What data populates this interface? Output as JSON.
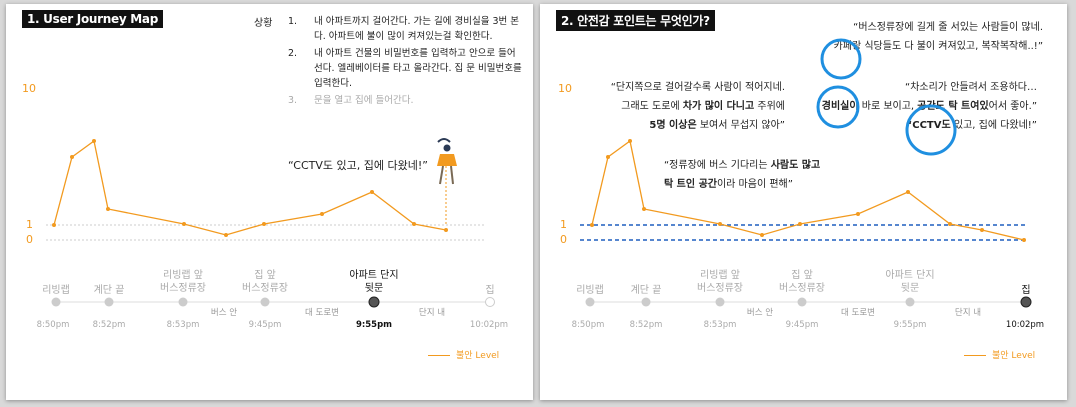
{
  "colors": {
    "line": "#f29a1f",
    "accent_blue": "#1f8fe0",
    "dashed_blue": "#1f5fbf"
  },
  "panel1": {
    "title": "1. User Journey Map",
    "steps_label": "상황",
    "steps": [
      {
        "num": "1.",
        "text": "내 아파트까지 걸어간다. 가는 길에 경비실을 3번 본다. 아파트에 불이 많이 켜져있는걸 확인한다."
      },
      {
        "num": "2.",
        "text": "내 아파트 건물의 비밀번호를 입력하고 안으로 들어선다. 엘레베이터를 타고 올라간다. 집 문 비밀번호를 입력한다."
      },
      {
        "num": "3.",
        "text": "문을 열고 집에 들어간다."
      }
    ],
    "quote": "“CCTV도 있고, 집에 다왔네!”",
    "figure_icon": "walking-woman-icon",
    "y_labels": {
      "top": "10",
      "one": "1",
      "zero": "0"
    },
    "stations": [
      {
        "name1": "리빙랩",
        "name2": "",
        "time": "8:50pm"
      },
      {
        "name1": "계단 끝",
        "name2": "",
        "time": "8:52pm"
      },
      {
        "name1": "리빙랩 앞",
        "name2": "버스정류장",
        "time": "8:53pm"
      },
      {
        "name1": "집 앞",
        "name2": "버스정류장",
        "time": "9:45pm"
      },
      {
        "name1": "아파트 단지",
        "name2": "뒷문",
        "time": "9:55pm"
      },
      {
        "name1": "집",
        "name2": "",
        "time": "10:02pm"
      }
    ],
    "segments": [
      "버스 안",
      "대 도로변",
      "단지 내"
    ],
    "legend": "불안 Level"
  },
  "panel2": {
    "title": "2. 안전감 포인트는 무엇인가?",
    "y_labels": {
      "top": "10",
      "one": "1",
      "zero": "0"
    },
    "quote_bus": {
      "l1a": "“버스정류장에 길게 줄 서있는 사람들이 많네.",
      "l2a": "카페랑 식당들도 다 불이 켜져있고, 복작복작해..!”"
    },
    "quote_left": {
      "l1": "“단지쪽으로 걸어갈수록 사람이 적어지네.",
      "l2a": "그래도 도로에 ",
      "l2b": "차가 많이 다니고",
      "l2c": " 주위에",
      "l3a": "5명 이상은",
      "l3b": " 보여서 무섭지 않아”"
    },
    "quote_right": {
      "l1": "“차소리가 안들려서 조용하다…",
      "l2a": "경비실이",
      "l2b": " 바로 보이고, ",
      "l2c": "공간도 탁 트여있",
      "l2d": "어서 좋아.”",
      "l3a": "“CCTV도",
      "l3b": " 있고, 집에 다왔네!”"
    },
    "quote_mid": {
      "l1a": "“정류장에 버스 기다리는 ",
      "l1b": "사람도 많고",
      "l2a": "탁 트인 공간",
      "l2b": "이라 마음이 편해”"
    },
    "stations": [
      {
        "name1": "리빙랩",
        "name2": "",
        "time": "8:50pm"
      },
      {
        "name1": "계단 끝",
        "name2": "",
        "time": "8:52pm"
      },
      {
        "name1": "리빙랩 앞",
        "name2": "버스정류장",
        "time": "8:53pm"
      },
      {
        "name1": "집 앞",
        "name2": "버스정류장",
        "time": "9:45pm"
      },
      {
        "name1": "아파트 단지",
        "name2": "뒷문",
        "time": "9:55pm"
      },
      {
        "name1": "집",
        "name2": "",
        "time": "10:02pm"
      }
    ],
    "segments": [
      "버스 안",
      "대 도로변",
      "단지 내"
    ],
    "legend": "불안 Level"
  }
}
